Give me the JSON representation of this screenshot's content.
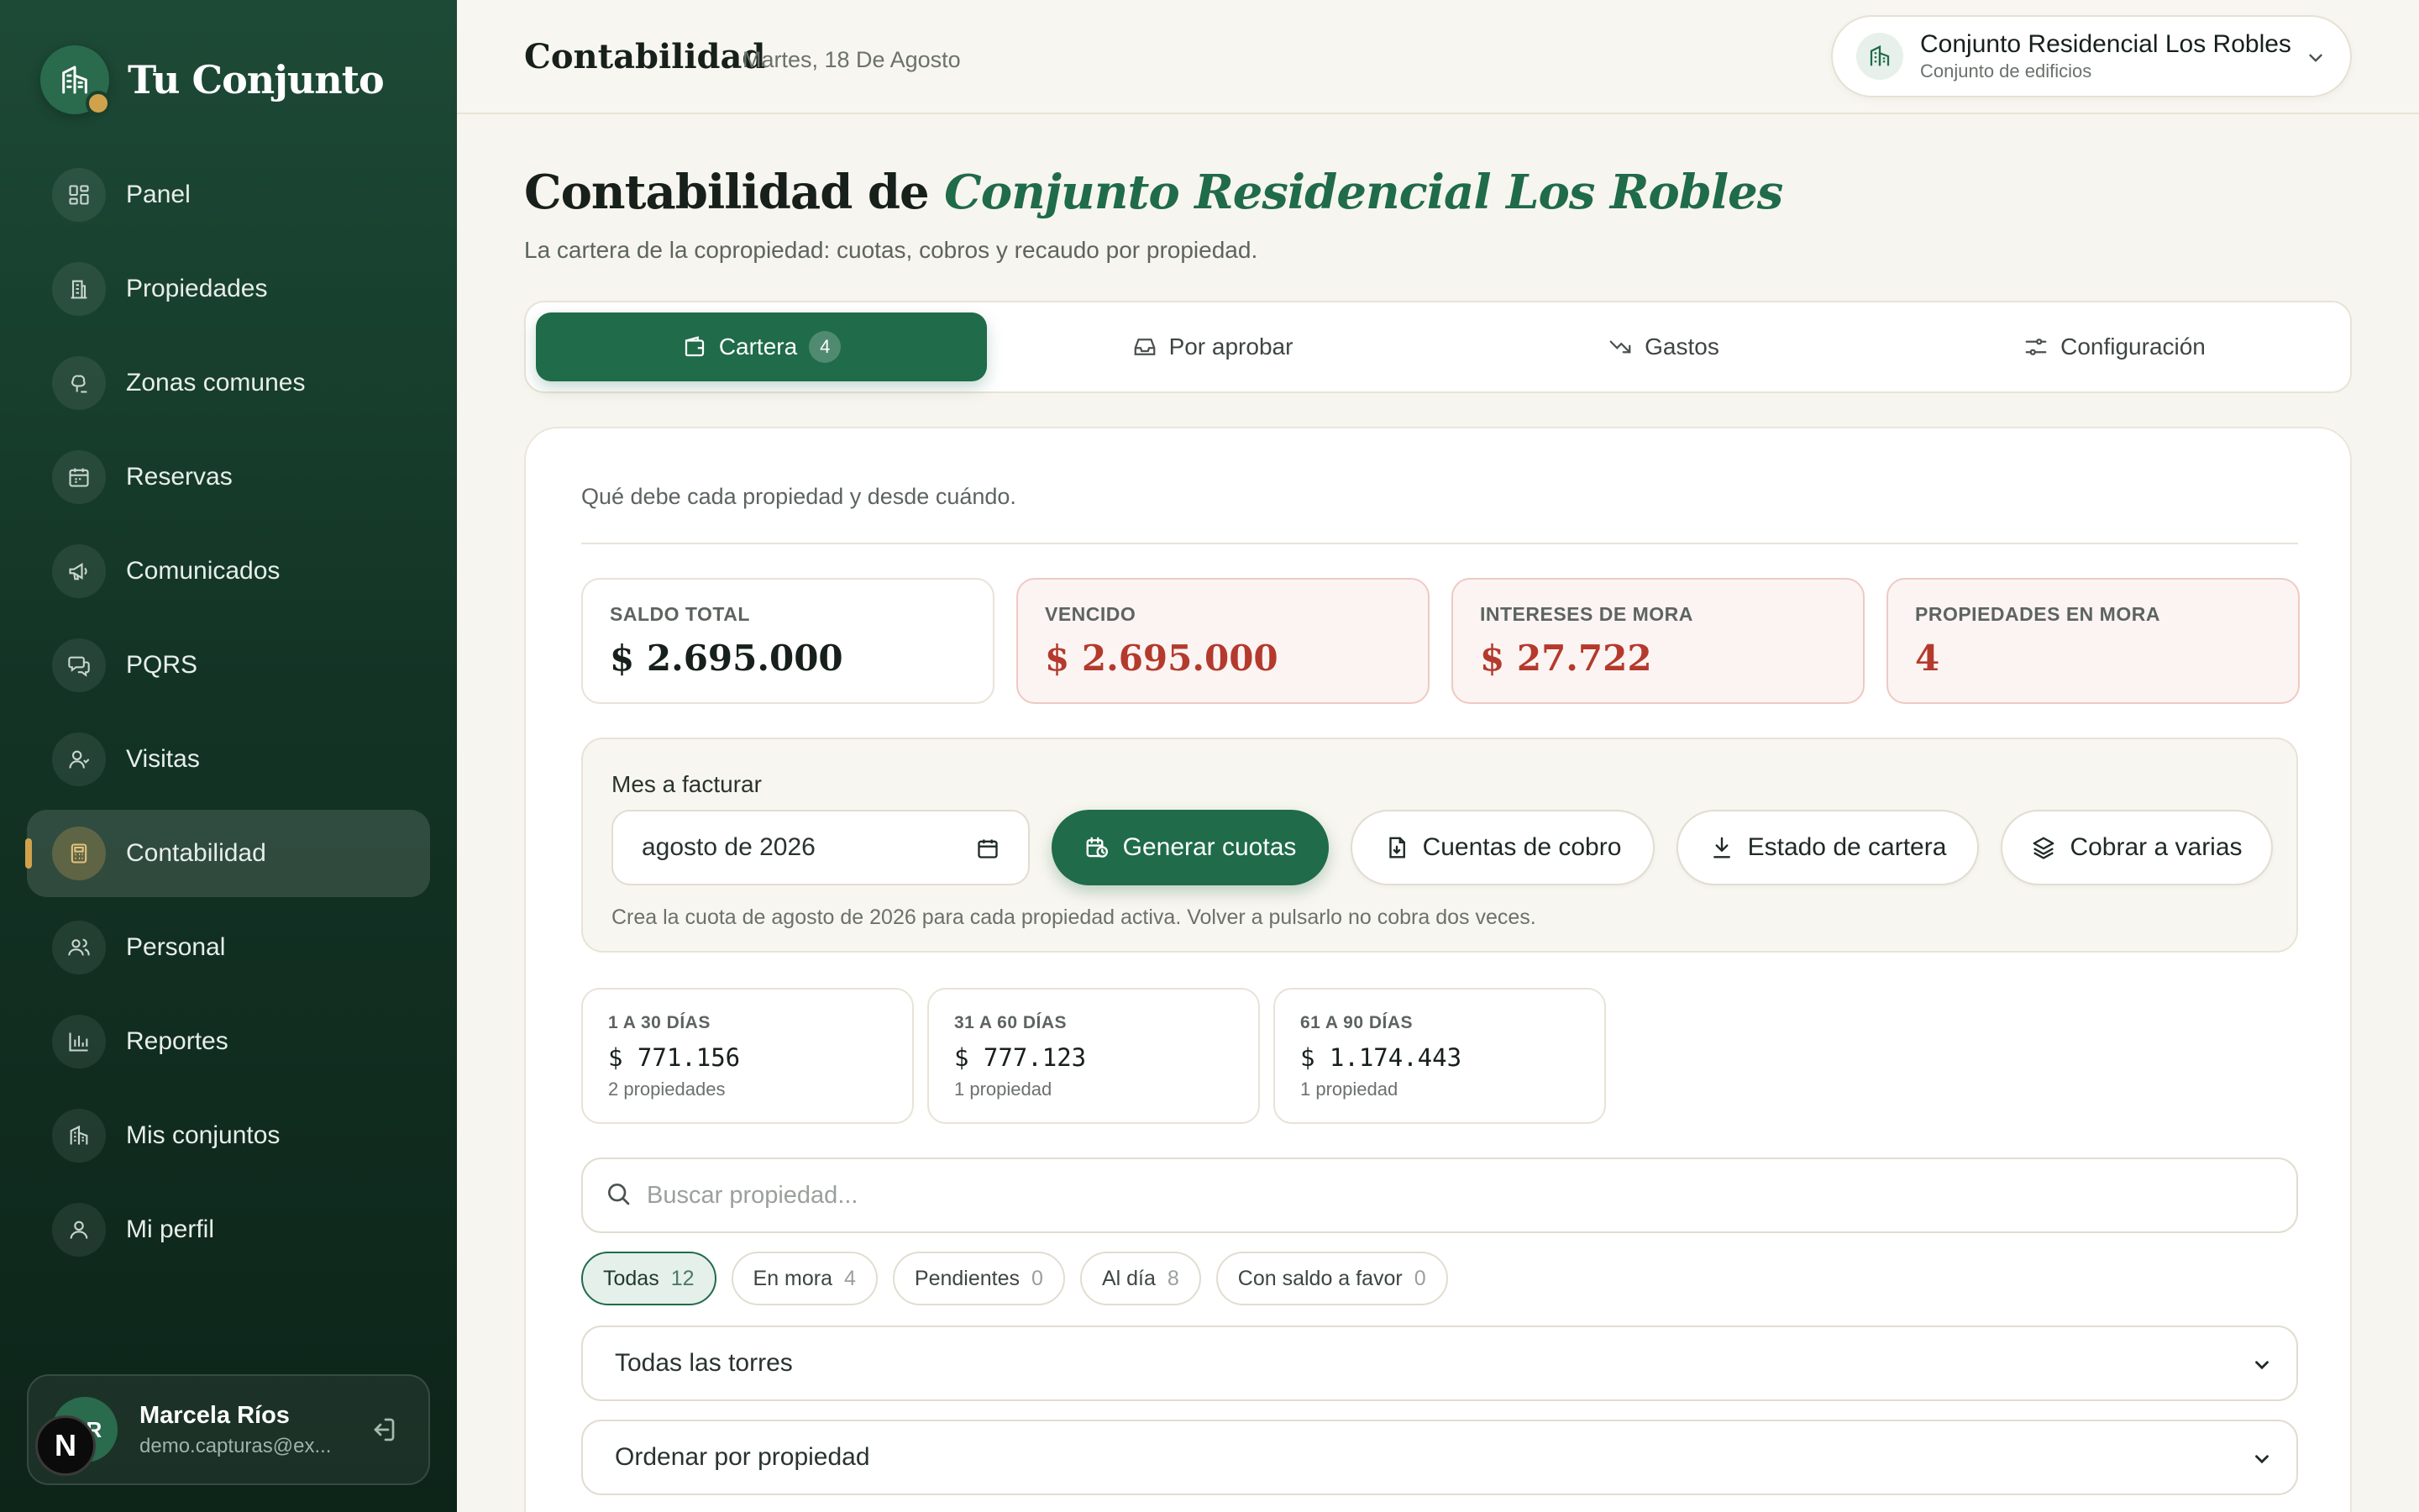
{
  "sidebar": {
    "brand_name": "Tu Conjunto",
    "items": [
      {
        "label": "Panel",
        "icon": "dashboard-icon"
      },
      {
        "label": "Propiedades",
        "icon": "building-icon"
      },
      {
        "label": "Zonas comunes",
        "icon": "tree-icon"
      },
      {
        "label": "Reservas",
        "icon": "calendar-icon"
      },
      {
        "label": "Comunicados",
        "icon": "megaphone-icon"
      },
      {
        "label": "PQRS",
        "icon": "chat-icon"
      },
      {
        "label": "Visitas",
        "icon": "user-icon"
      },
      {
        "label": "Contabilidad",
        "icon": "calculator-icon",
        "active": true
      },
      {
        "label": "Personal",
        "icon": "users-icon"
      },
      {
        "label": "Reportes",
        "icon": "bar-chart-icon"
      },
      {
        "label": "Mis conjuntos",
        "icon": "buildings-icon"
      },
      {
        "label": "Mi perfil",
        "icon": "profile-icon"
      }
    ],
    "user": {
      "initials": "MR",
      "badge": "N",
      "name": "Marcela Ríos",
      "email": "demo.capturas@ex..."
    }
  },
  "topbar": {
    "title": "Contabilidad",
    "date": "Martes, 18 De Agosto",
    "building": {
      "name": "Conjunto Residencial Los Robles",
      "type": "Conjunto de edificios"
    }
  },
  "page": {
    "title_prefix": "Contabilidad de",
    "title_accent": "Conjunto Residencial Los Robles",
    "subtitle": "La cartera de la copropiedad: cuotas, cobros y recaudo por propiedad."
  },
  "tabs": [
    {
      "label": "Cartera",
      "badge": "4",
      "active": true
    },
    {
      "label": "Por aprobar"
    },
    {
      "label": "Gastos"
    },
    {
      "label": "Configuración"
    }
  ],
  "cartera": {
    "intro": "Qué debe cada propiedad y desde cuándo.",
    "stats": [
      {
        "label": "SALDO TOTAL",
        "value": "$ 2.695.000"
      },
      {
        "label": "VENCIDO",
        "value": "$ 2.695.000"
      },
      {
        "label": "INTERESES DE MORA",
        "value": "$ 27.722"
      },
      {
        "label": "PROPIEDADES EN MORA",
        "value": "4"
      }
    ],
    "billing": {
      "label": "Mes a facturar",
      "month_value": "agosto de 2026",
      "generate_label": "Generar cuotas",
      "cuentas_label": "Cuentas de cobro",
      "estado_label": "Estado de cartera",
      "cobrar_label": "Cobrar a varias",
      "help": "Crea la cuota de agosto de 2026 para cada propiedad activa. Volver a pulsarlo no cobra dos veces."
    },
    "aging": [
      {
        "label": "1 A 30 DÍAS",
        "value": "$ 771.156",
        "sub": "2 propiedades"
      },
      {
        "label": "31 A 60 DÍAS",
        "value": "$ 777.123",
        "sub": "1 propiedad"
      },
      {
        "label": "61 A 90 DÍAS",
        "value": "$ 1.174.443",
        "sub": "1 propiedad"
      }
    ],
    "search_placeholder": "Buscar propiedad...",
    "filters": [
      {
        "label": "Todas",
        "count": "12",
        "active": true
      },
      {
        "label": "En mora",
        "count": "4"
      },
      {
        "label": "Pendientes",
        "count": "0"
      },
      {
        "label": "Al día",
        "count": "8"
      },
      {
        "label": "Con saldo a favor",
        "count": "0"
      }
    ],
    "tower_select": "Todas las torres",
    "order_select": "Ordenar por propiedad"
  },
  "colors": {
    "accent": "#1f6b4a",
    "sidebar": "#133425",
    "danger": "#b43a2d",
    "gold": "#d1a24c"
  }
}
